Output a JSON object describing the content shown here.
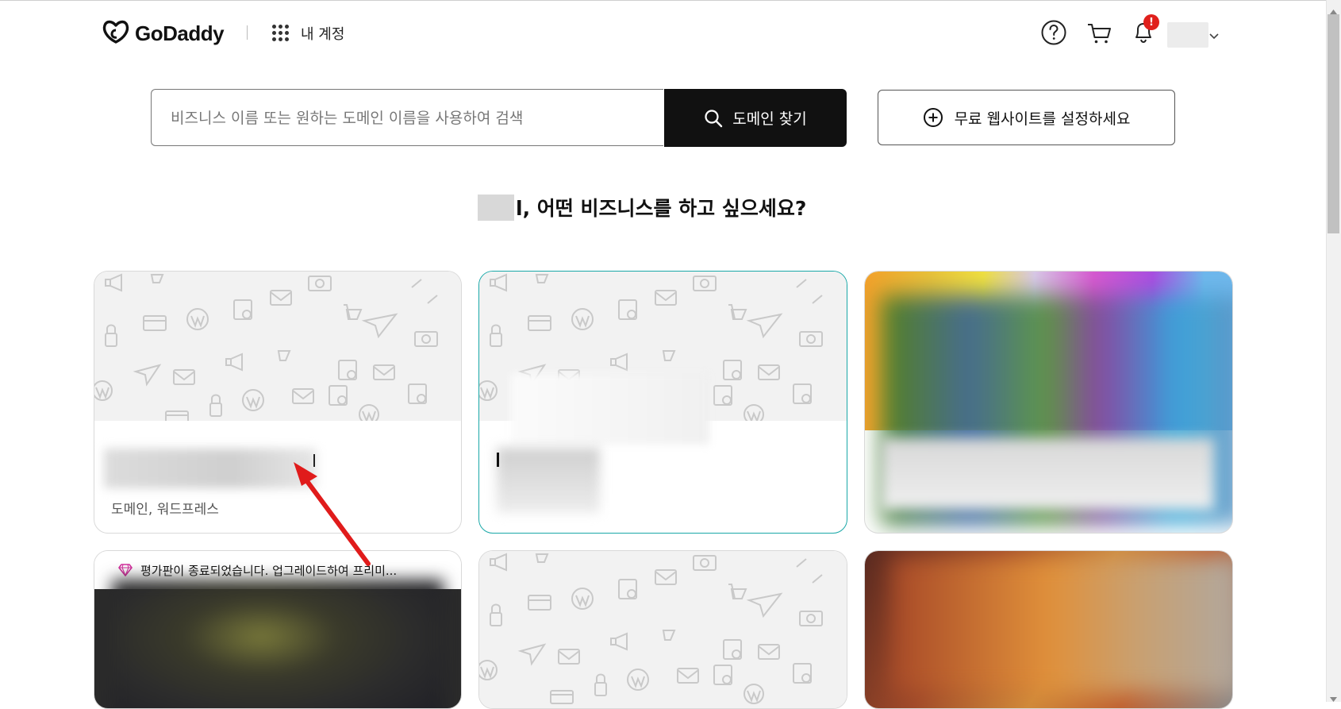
{
  "header": {
    "brand": "GoDaddy",
    "apps_label": "내 계정",
    "notification_badge": "!"
  },
  "search": {
    "placeholder": "비즈니스 이름 또는 원하는 도메인 이름을 사용하여 검색",
    "button_label": "도메인 찾기"
  },
  "website_button": {
    "label": "무료 웹사이트를 설정하세요"
  },
  "greeting": {
    "text": "l, 어떤 비즈니스를 하고 싶으세요?"
  },
  "cards": [
    {
      "subtitle": "도메인, 워드프레스"
    },
    {
      "subtitle": ""
    },
    {
      "subtitle": ""
    },
    {
      "banner": "평가판이 종료되었습니다. 업그레이드하여 프리미..."
    },
    {
      "subtitle": ""
    },
    {
      "subtitle": ""
    }
  ],
  "colors": {
    "accent_dark": "#111111",
    "selected_card_border": "#1aa8a8",
    "notification_red": "#e0201c",
    "annotation_arrow": "#e01b1b",
    "premium_gem": "#d42f9e"
  },
  "icons": [
    "godaddy-logo-icon",
    "apps-grid-icon",
    "help-icon",
    "cart-icon",
    "bell-icon",
    "chevron-down-icon",
    "search-icon",
    "plus-circle-icon",
    "gem-icon"
  ]
}
